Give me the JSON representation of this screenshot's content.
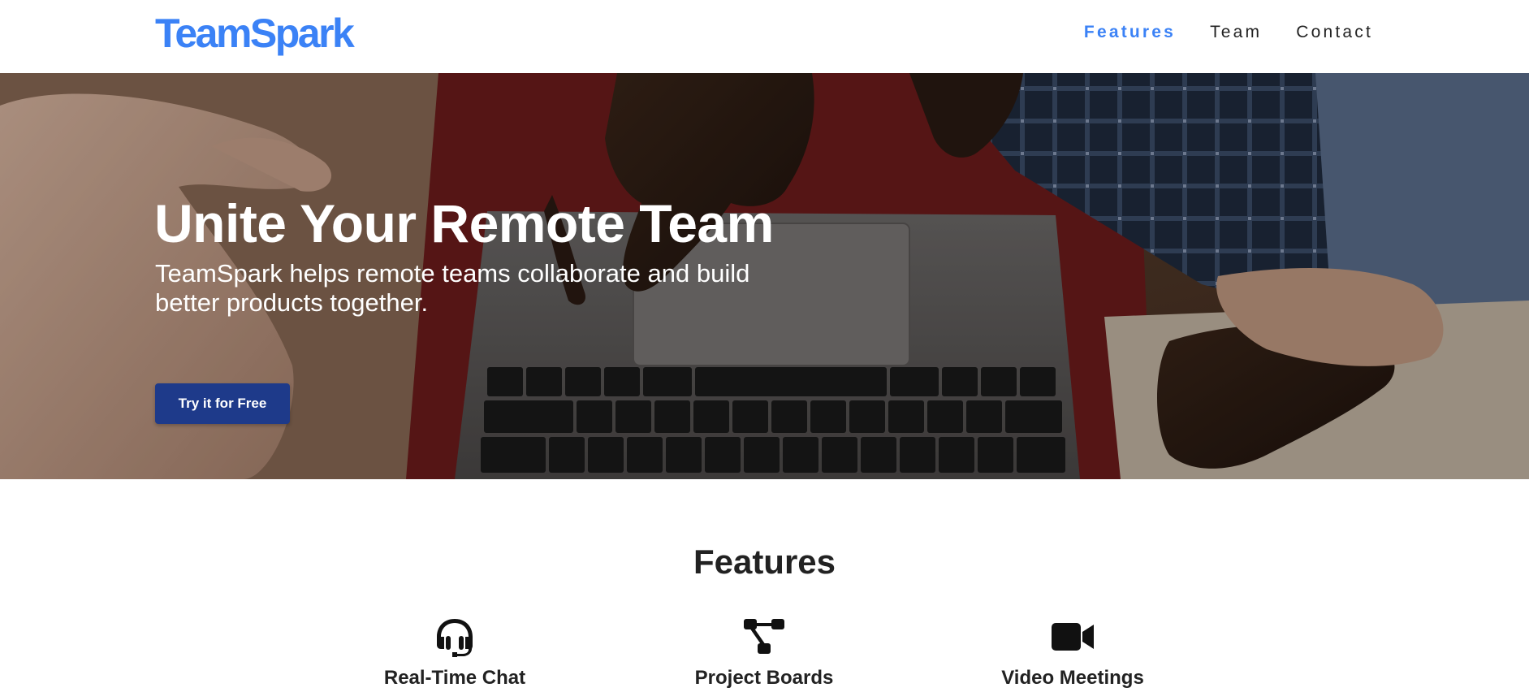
{
  "header": {
    "logo": "TeamSpark",
    "nav": [
      {
        "label": "Features",
        "active": true
      },
      {
        "label": "Team",
        "active": false
      },
      {
        "label": "Contact",
        "active": false
      }
    ]
  },
  "hero": {
    "title": "Unite Your Remote Team",
    "subtitle": "TeamSpark helps remote teams collaborate and build better products together.",
    "cta_label": "Try it for Free"
  },
  "features": {
    "title": "Features",
    "items": [
      {
        "label": "Real-Time Chat",
        "icon": "headset-icon"
      },
      {
        "label": "Project Boards",
        "icon": "project-diagram-icon"
      },
      {
        "label": "Video Meetings",
        "icon": "video-camera-icon"
      }
    ]
  },
  "colors": {
    "brand": "#3b82f6",
    "cta": "#1e3a8a",
    "text": "#222222"
  }
}
